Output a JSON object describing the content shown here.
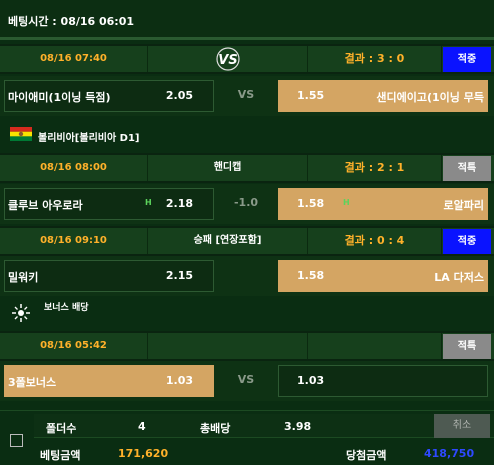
{
  "header": {
    "bet_time": "베팅시간 : 08/16 06:01"
  },
  "games": [
    {
      "time": "08/16 07:40",
      "market": "",
      "result": "결과 : 3 : 0",
      "status": "적중",
      "status_color": "#0a13ff",
      "home": {
        "name": "마이애미(1이닝 득점)",
        "odds": "2.05",
        "selected": false
      },
      "draw": "VS",
      "away": {
        "name": "샌디에이고(1이닝 무득",
        "odds": "1.55",
        "selected": true
      }
    },
    {
      "time": "08/16 08:00",
      "market": "핸디캡",
      "result": "결과 : 2 : 1",
      "status": "적특",
      "status_color": "#8a8a8a",
      "home": {
        "name": "클루브 아우로라",
        "odds": "2.18",
        "handicap_marker": "H",
        "selected": false
      },
      "draw": "-1.0",
      "away": {
        "name": "로알파리",
        "odds": "1.58",
        "handicap_marker": "H",
        "selected": true
      }
    },
    {
      "time": "08/16 09:10",
      "market": "승패 [연장포함]",
      "result": "결과 : 0 : 4",
      "status": "적중",
      "status_color": "#0a13ff",
      "home": {
        "name": "밀워키",
        "odds": "2.15",
        "selected": false
      },
      "draw": "",
      "away": {
        "name": "LA 다저스",
        "odds": "1.58",
        "selected": true
      }
    },
    {
      "time": "08/16 05:42",
      "market": "",
      "result": "",
      "status": "적특",
      "status_color": "#8a8a8a",
      "home": {
        "name": "3폴보너스",
        "odds": "1.03",
        "selected": true
      },
      "draw": "VS",
      "away": {
        "name": "",
        "odds": "1.03",
        "selected": false
      }
    }
  ],
  "league": {
    "name": "볼리비아[볼리비아 D1]",
    "flag_icon": "bolivia-flag-icon"
  },
  "bonus": {
    "label": "보너스 배당",
    "icon": "bonus-star-icon"
  },
  "vs_logo": "VS",
  "summary": {
    "folders_label": "폴더수",
    "folders_value": "4",
    "total_odds_label": "총배당",
    "total_odds_value": "3.98",
    "bet_amount_label": "베팅금액",
    "bet_amount_value": "171,620",
    "win_amount_label": "당첨금액",
    "win_amount_value": "418,750",
    "cancel_label": "취소"
  },
  "colors": {
    "accent_orange": "#ffb12a",
    "selected_bg": "#d4a563",
    "win_blue": "#0a13ff"
  }
}
